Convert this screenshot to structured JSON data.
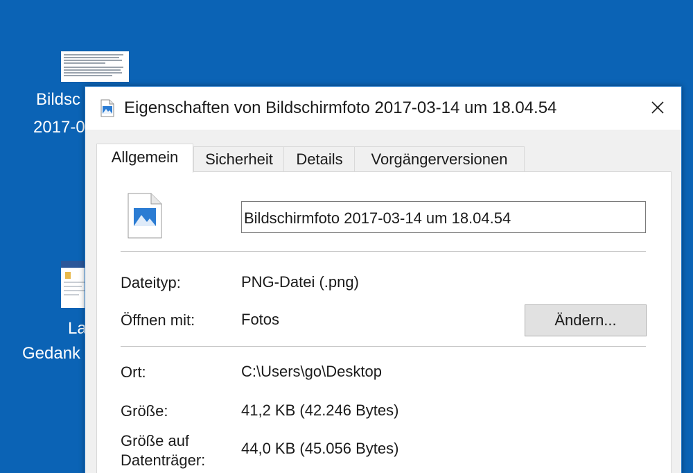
{
  "desktop": {
    "icon1": {
      "line1": "Bildsc",
      "line2": "2017-0"
    },
    "icon2": {
      "line1": "La",
      "line2": "Gedank"
    }
  },
  "dialog": {
    "title": "Eigenschaften von Bildschirmfoto 2017-03-14 um 18.04.54",
    "tabs": [
      {
        "label": "Allgemein",
        "active": true
      },
      {
        "label": "Sicherheit",
        "active": false
      },
      {
        "label": "Details",
        "active": false
      },
      {
        "label": "Vorgängerversionen",
        "active": false
      }
    ],
    "filename": "Bildschirmfoto 2017-03-14 um 18.04.54",
    "fields": {
      "dateityp_label": "Dateityp:",
      "dateityp_value": "PNG-Datei (.png)",
      "oeffnen_label": "Öffnen mit:",
      "oeffnen_value": "Fotos",
      "aendern_button": "Ändern...",
      "ort_label": "Ort:",
      "ort_value": "C:\\Users\\go\\Desktop",
      "groesse_label": "Größe:",
      "groesse_value": "41,2 KB (42.246 Bytes)",
      "groesse_dt_label_1": "Größe auf",
      "groesse_dt_label_2": "Datenträger:",
      "groesse_dt_value": "44,0 KB (45.056 Bytes)"
    }
  },
  "colors": {
    "desktop_bg": "#0b63b5",
    "accent": "#1f74c4",
    "icon_blue": "#2b7cd3"
  },
  "icons": [
    "image-file-icon",
    "close-icon",
    "document-thumbnail-icon",
    "word-document-icon"
  ]
}
